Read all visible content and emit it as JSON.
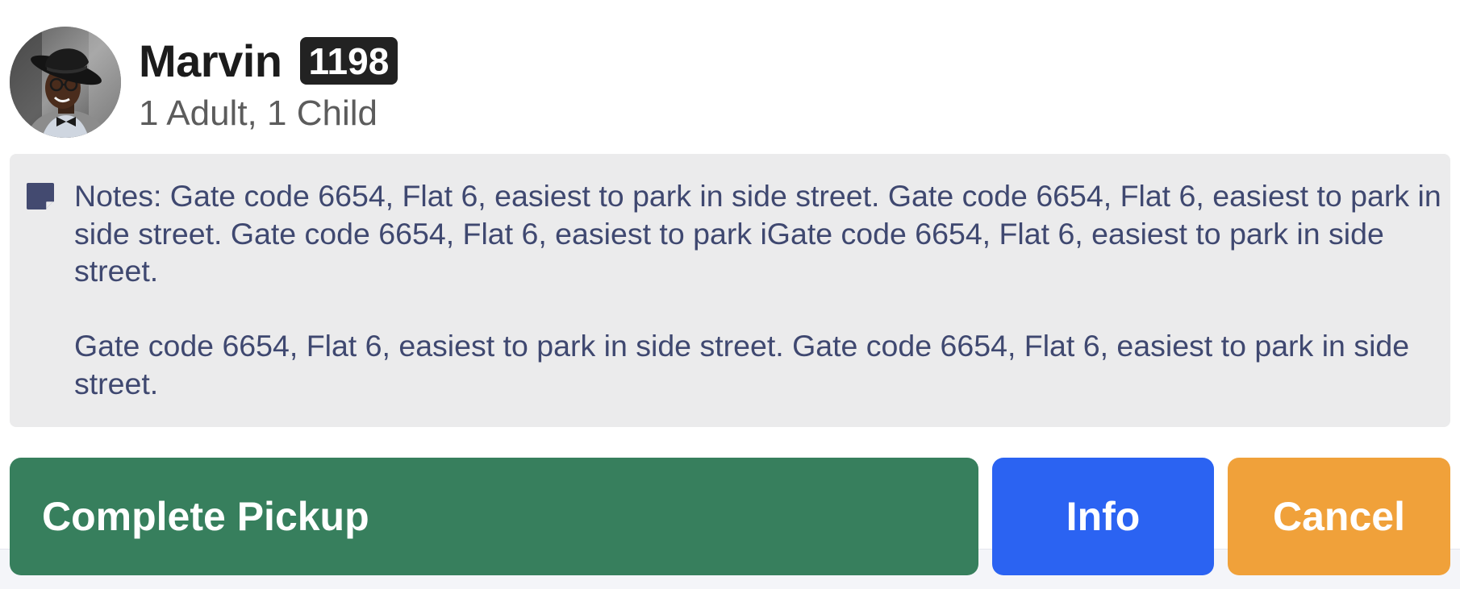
{
  "customer": {
    "name": "Marvin",
    "id_badge": "1198",
    "party": "1 Adult, 1 Child",
    "avatar_icon": "person-photo"
  },
  "notes": {
    "icon": "sticky-note-icon",
    "text": "Notes: Gate code 6654, Flat 6, easiest to park in side street. Gate code 6654, Flat 6, easiest to park in side street. Gate code 6654, Flat 6, easiest to park iGate code 6654, Flat 6, easiest to park in side street.\n\nGate code 6654, Flat 6, easiest to park in side street. Gate code 6654, Flat 6, easiest to park in side street."
  },
  "actions": {
    "complete_label": "Complete Pickup",
    "info_label": "Info",
    "cancel_label": "Cancel"
  },
  "colors": {
    "complete": "#377f5d",
    "info": "#2b63f2",
    "cancel": "#f0a13a",
    "notes_bg": "#ebebec",
    "notes_text": "#3f4870"
  }
}
